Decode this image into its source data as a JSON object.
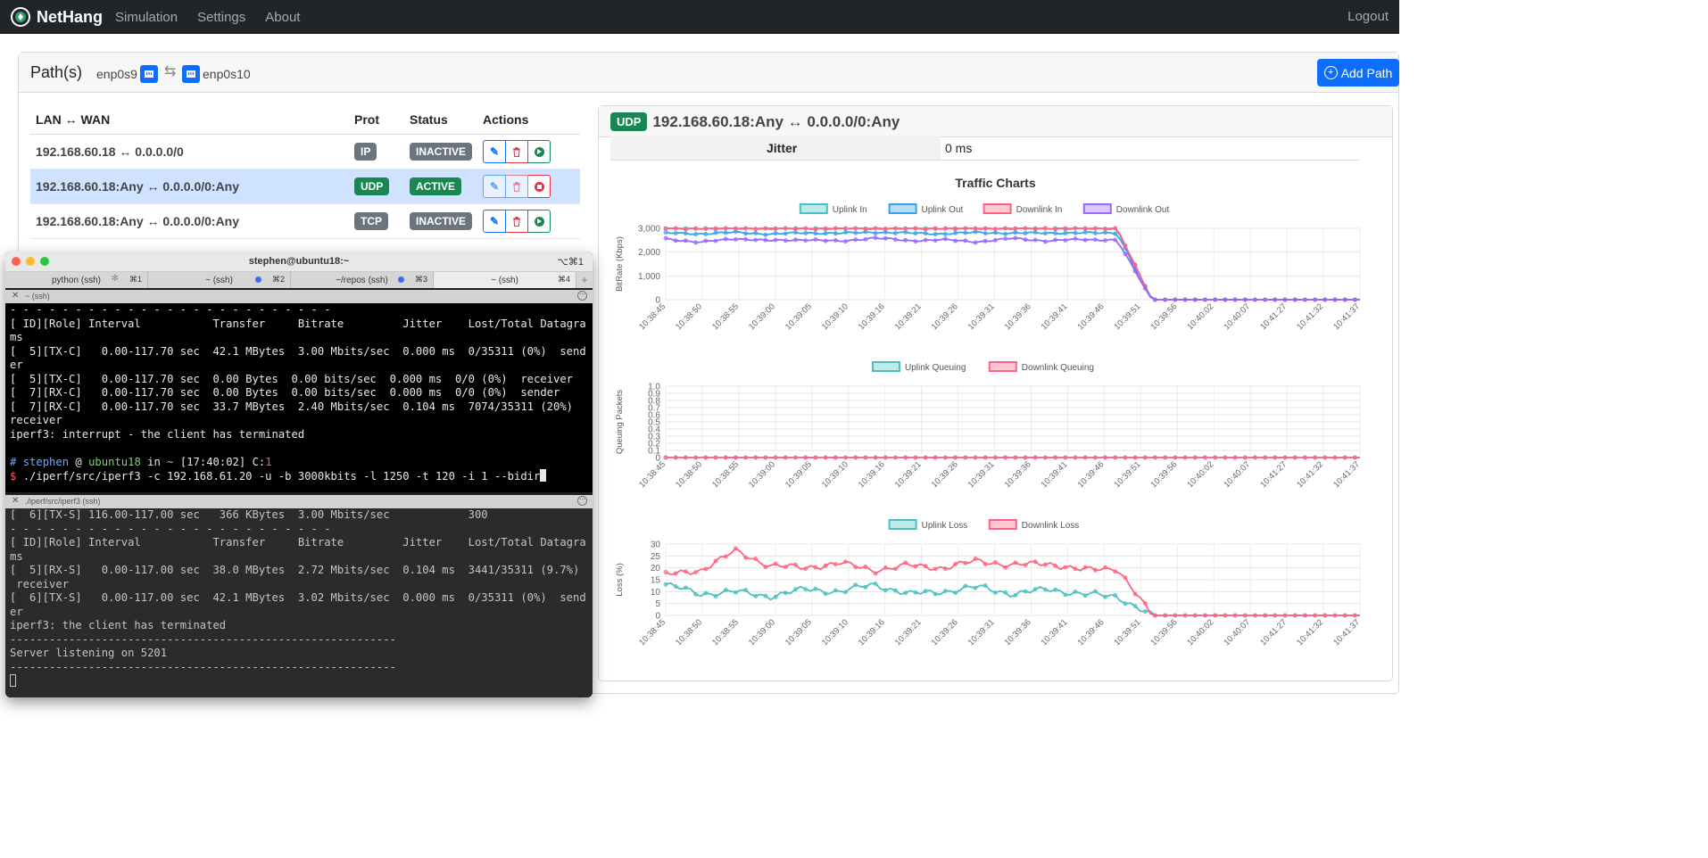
{
  "navbar": {
    "brand": "NetHang",
    "links": [
      "Simulation",
      "Settings",
      "About"
    ],
    "logout": "Logout"
  },
  "paths": {
    "title": "Path(s)",
    "lan_iface": "enp0s9",
    "wan_iface": "enp0s10",
    "add_button": "Add Path",
    "columns": [
      "LAN ↔ WAN",
      "Prot",
      "Status",
      "Actions"
    ],
    "rows": [
      {
        "route": "192.168.60.18 ↔ 0.0.0.0/0",
        "prot": "IP",
        "status": "INACTIVE",
        "active": false
      },
      {
        "route": "192.168.60.18:Any ↔ 0.0.0.0/0:Any",
        "prot": "UDP",
        "status": "ACTIVE",
        "active": true
      },
      {
        "route": "192.168.60.18:Any ↔ 0.0.0.0/0:Any",
        "prot": "TCP",
        "status": "INACTIVE",
        "active": false
      }
    ]
  },
  "detail": {
    "protocol": "UDP",
    "title": "192.168.60.18:Any ↔ 0.0.0.0/0:Any",
    "jitter_label": "Jitter",
    "jitter_value": "0 ms",
    "charts_title": "Traffic Charts"
  },
  "chart_data": [
    {
      "type": "line",
      "ylabel": "BitRate (Kbps)",
      "ylim": [
        0,
        3000
      ],
      "yticks": [
        "3,000",
        "2,000",
        "1,000",
        "0"
      ],
      "x": [
        "10:38:45",
        "10:38:50",
        "10:38:55",
        "10:39:00",
        "10:39:05",
        "10:39:10",
        "10:39:16",
        "10:39:21",
        "10:39:26",
        "10:39:31",
        "10:39:36",
        "10:39:41",
        "10:39:46",
        "10:39:51",
        "10:39:56",
        "10:40:02",
        "10:40:07",
        "10:41:27",
        "10:41:32",
        "10:41:37"
      ],
      "legend": "top",
      "series": [
        {
          "name": "Uplink In",
          "color": "#4bc0c0",
          "profile": [
            3000,
            3000,
            3000,
            3000,
            3000,
            3000,
            3000,
            3000,
            3000,
            3000,
            3000,
            3000,
            3000,
            3000,
            0,
            0,
            0,
            0,
            0,
            0,
            0
          ]
        },
        {
          "name": "Uplink Out",
          "color": "#36a2eb",
          "profile": [
            2800,
            2770,
            2830,
            2760,
            2810,
            2790,
            2840,
            2800,
            2770,
            2830,
            2790,
            2810,
            2800,
            2820,
            0,
            0,
            0,
            0,
            0,
            0,
            0
          ]
        },
        {
          "name": "Downlink In",
          "color": "#ff6384",
          "profile": [
            3000,
            3000,
            3000,
            3000,
            3000,
            3000,
            3000,
            3000,
            3000,
            3000,
            3000,
            3000,
            3000,
            3000,
            0,
            0,
            0,
            0,
            0,
            0,
            0
          ]
        },
        {
          "name": "Downlink Out",
          "color": "#9966ff",
          "profile": [
            2560,
            2410,
            2570,
            2480,
            2530,
            2450,
            2600,
            2480,
            2520,
            2430,
            2580,
            2470,
            2540,
            2500,
            0,
            0,
            0,
            0,
            0,
            0,
            0
          ]
        }
      ]
    },
    {
      "type": "line",
      "ylabel": "Queuing Packets",
      "ylim": [
        0,
        1
      ],
      "yticks": [
        "1.0",
        "0.9",
        "0.8",
        "0.7",
        "0.6",
        "0.5",
        "0.4",
        "0.3",
        "0.2",
        "0.1",
        "0"
      ],
      "x": [
        "10:38:45",
        "10:38:50",
        "10:38:55",
        "10:39:00",
        "10:39:05",
        "10:39:10",
        "10:39:16",
        "10:39:21",
        "10:39:26",
        "10:39:31",
        "10:39:36",
        "10:39:41",
        "10:39:46",
        "10:39:51",
        "10:39:56",
        "10:40:02",
        "10:40:07",
        "10:41:27",
        "10:41:32",
        "10:41:37"
      ],
      "legend": "top",
      "series": [
        {
          "name": "Uplink Queuing",
          "color": "#4bc0c0",
          "profile": [
            0,
            0,
            0,
            0,
            0,
            0,
            0,
            0,
            0,
            0,
            0,
            0,
            0,
            0,
            0,
            0,
            0,
            0,
            0,
            0,
            0
          ]
        },
        {
          "name": "Downlink Queuing",
          "color": "#ff6384",
          "profile": [
            0,
            0,
            0,
            0,
            0,
            0,
            0,
            0,
            0,
            0,
            0,
            0,
            0,
            0,
            0,
            0,
            0,
            0,
            0,
            0,
            0
          ]
        }
      ]
    },
    {
      "type": "line",
      "ylabel": "Loss (%)",
      "ylim": [
        0,
        30
      ],
      "yticks": [
        "30",
        "25",
        "20",
        "15",
        "10",
        "5",
        "0"
      ],
      "x": [
        "10:38:45",
        "10:38:50",
        "10:38:55",
        "10:39:00",
        "10:39:05",
        "10:39:10",
        "10:39:16",
        "10:39:21",
        "10:39:26",
        "10:39:31",
        "10:39:36",
        "10:39:41",
        "10:39:46",
        "10:39:51",
        "10:39:56",
        "10:40:02",
        "10:40:07",
        "10:41:27",
        "10:41:32",
        "10:41:37"
      ],
      "legend": "top",
      "series": [
        {
          "name": "Uplink Loss",
          "color": "#4bc0c0",
          "profile": [
            13,
            9,
            10,
            8,
            11,
            10,
            13,
            9,
            10,
            12,
            9,
            11,
            9,
            8,
            0,
            0,
            0,
            0,
            0,
            0,
            0
          ]
        },
        {
          "name": "Downlink Loss",
          "color": "#ff6384",
          "profile": [
            17,
            19,
            27,
            21,
            20,
            22,
            19,
            21,
            20,
            23,
            21,
            22,
            19,
            20,
            0,
            0,
            0,
            0,
            0,
            0,
            0
          ]
        }
      ]
    }
  ],
  "terminal": {
    "title": "stephen@ubuntu18:~",
    "shortcut": "⌥⌘1",
    "tabs": [
      {
        "label": "python (ssh)",
        "key": "⌘1"
      },
      {
        "label": "~ (ssh)",
        "key": "⌘2"
      },
      {
        "label": "~/repos (ssh)",
        "key": "⌘3"
      },
      {
        "label": "~ (ssh)",
        "key": "⌘4"
      }
    ],
    "pane1_label": "~ (ssh)",
    "pane2_label": "./iperf/src/iperf3 (ssh)",
    "pane1_lines": [
      "- - - - - - - - - - - - - - - - - - - - - - - - -",
      "[ ID][Role] Interval           Transfer     Bitrate         Jitter    Lost/Total Datagra",
      "ms",
      "[  5][TX-C]   0.00-117.70 sec  42.1 MBytes  3.00 Mbits/sec  0.000 ms  0/35311 (0%)  send",
      "er",
      "[  5][TX-C]   0.00-117.70 sec  0.00 Bytes  0.00 bits/sec  0.000 ms  0/0 (0%)  receiver",
      "[  7][RX-C]   0.00-117.70 sec  0.00 Bytes  0.00 bits/sec  0.000 ms  0/0 (0%)  sender",
      "[  7][RX-C]   0.00-117.70 sec  33.7 MBytes  2.40 Mbits/sec  0.104 ms  7074/35311 (20%)",
      "receiver",
      "iperf3: interrupt - the client has terminated",
      ""
    ],
    "prompt": {
      "hash": "#",
      "user": "stephen",
      "at": "@",
      "host": "ubuntu18",
      "in": "in",
      "dir": "~",
      "time": "[17:40:02]",
      "code_label": "C:",
      "code": "1",
      "dollar": "$",
      "command": "./iperf/src/iperf3 -c 192.168.61.20 -u -b 3000kbits -l 1250 -t 120 -i 1 --bidir"
    },
    "pane2_lines": [
      "[  6][TX-S] 116.00-117.00 sec   366 KBytes  3.00 Mbits/sec            300",
      "- - - - - - - - - - - - - - - - - - - - - - - - -",
      "[ ID][Role] Interval           Transfer     Bitrate         Jitter    Lost/Total Datagra",
      "ms",
      "[  5][RX-S]   0.00-117.00 sec  38.0 MBytes  2.72 Mbits/sec  0.104 ms  3441/35311 (9.7%)",
      " receiver",
      "[  6][TX-S]   0.00-117.00 sec  42.1 MBytes  3.02 Mbits/sec  0.000 ms  0/35311 (0%)  send",
      "er",
      "iperf3: the client has terminated",
      "-----------------------------------------------------------",
      "Server listening on 5201",
      "-----------------------------------------------------------"
    ]
  }
}
